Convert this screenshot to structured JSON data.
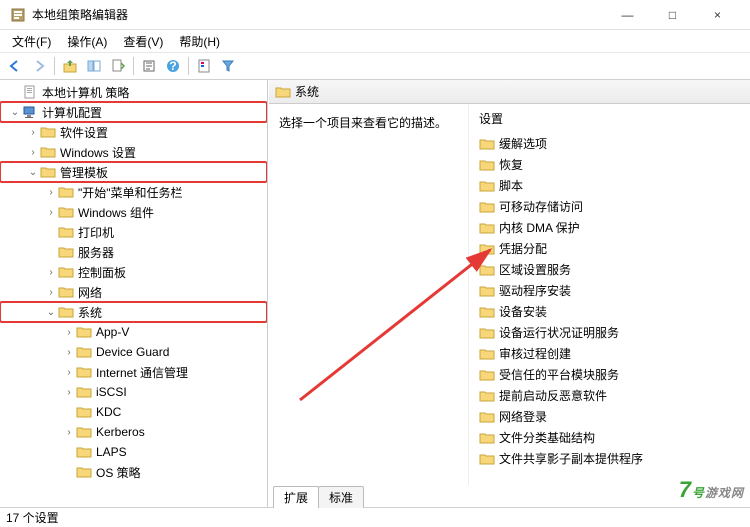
{
  "window": {
    "title": "本地组策略编辑器",
    "min": "—",
    "max": "□",
    "close": "×"
  },
  "menu": [
    "文件(F)",
    "操作(A)",
    "查看(V)",
    "帮助(H)"
  ],
  "tree": [
    {
      "indent": 0,
      "exp": "",
      "icon": "doc",
      "label": "本地计算机 策略"
    },
    {
      "indent": 0,
      "exp": "v",
      "icon": "comp",
      "label": "计算机配置",
      "hl": true
    },
    {
      "indent": 1,
      "exp": ">",
      "icon": "folder",
      "label": "软件设置"
    },
    {
      "indent": 1,
      "exp": ">",
      "icon": "folder",
      "label": "Windows 设置"
    },
    {
      "indent": 1,
      "exp": "v",
      "icon": "folder",
      "label": "管理模板",
      "hl": true
    },
    {
      "indent": 2,
      "exp": ">",
      "icon": "folder",
      "label": "\"开始\"菜单和任务栏"
    },
    {
      "indent": 2,
      "exp": ">",
      "icon": "folder",
      "label": "Windows 组件"
    },
    {
      "indent": 2,
      "exp": "",
      "icon": "folder",
      "label": "打印机"
    },
    {
      "indent": 2,
      "exp": "",
      "icon": "folder",
      "label": "服务器"
    },
    {
      "indent": 2,
      "exp": ">",
      "icon": "folder",
      "label": "控制面板"
    },
    {
      "indent": 2,
      "exp": ">",
      "icon": "folder",
      "label": "网络"
    },
    {
      "indent": 2,
      "exp": "v",
      "icon": "folder",
      "label": "系统",
      "hl": true
    },
    {
      "indent": 3,
      "exp": ">",
      "icon": "folder",
      "label": "App-V"
    },
    {
      "indent": 3,
      "exp": ">",
      "icon": "folder",
      "label": "Device Guard"
    },
    {
      "indent": 3,
      "exp": ">",
      "icon": "folder",
      "label": "Internet 通信管理"
    },
    {
      "indent": 3,
      "exp": ">",
      "icon": "folder",
      "label": "iSCSI"
    },
    {
      "indent": 3,
      "exp": "",
      "icon": "folder",
      "label": "KDC"
    },
    {
      "indent": 3,
      "exp": ">",
      "icon": "folder",
      "label": "Kerberos"
    },
    {
      "indent": 3,
      "exp": "",
      "icon": "folder",
      "label": "LAPS"
    },
    {
      "indent": 3,
      "exp": "",
      "icon": "folder",
      "label": "OS 策略"
    }
  ],
  "right": {
    "header": "系统",
    "desc": "选择一个项目来查看它的描述。",
    "list_header": "设置",
    "items": [
      "缓解选项",
      "恢复",
      "脚本",
      "可移动存储访问",
      "内核 DMA 保护",
      "凭据分配",
      "区域设置服务",
      "驱动程序安装",
      "设备安装",
      "设备运行状况证明服务",
      "审核过程创建",
      "受信任的平台模块服务",
      "提前启动反恶意软件",
      "网络登录",
      "文件分类基础结构",
      "文件共享影子副本提供程序"
    ]
  },
  "tabs": [
    "扩展",
    "标准"
  ],
  "status": "17 个设置",
  "watermark": {
    "num": "7",
    "hao": "号",
    "cn": "游戏网"
  }
}
